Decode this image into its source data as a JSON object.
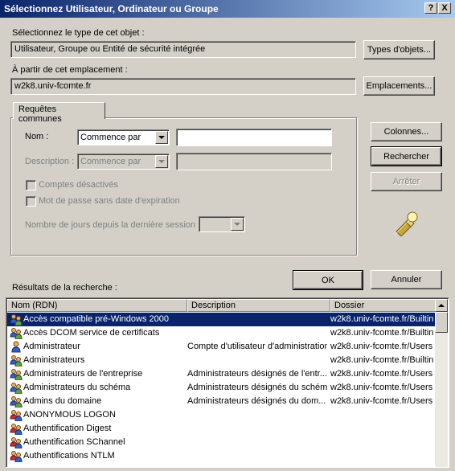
{
  "window": {
    "title": "Sélectionnez Utilisateur, Ordinateur ou Groupe",
    "help_glyph": "?",
    "close_glyph": "X"
  },
  "object_type": {
    "label": "Sélectionnez le type de cet objet :",
    "value": "Utilisateur, Groupe ou Entité de sécurité intégrée",
    "button": "Types d'objets..."
  },
  "location": {
    "label": "À partir de cet emplacement :",
    "value": "w2k8.univ-fcomte.fr",
    "button": "Emplacements..."
  },
  "common_queries": {
    "tab": "Requêtes communes",
    "name_label": "Nom :",
    "name_mode": "Commence par",
    "name_value": "",
    "description_label": "Description :",
    "description_mode": "Commence par",
    "disabled_accounts": "Comptes désactivés",
    "no_expire_password": "Mot de passe sans date d'expiration",
    "days_label": "Nombre de jours depuis la dernière session :"
  },
  "buttons": {
    "columns": "Colonnes...",
    "search": "Rechercher",
    "stop": "Arrêter",
    "ok": "OK",
    "cancel": "Annuler"
  },
  "results": {
    "label": "Résultats de la recherche :",
    "columns": [
      "Nom (RDN)",
      "Description",
      "Dossier"
    ],
    "rows": [
      {
        "name": "Accès compatible pré-Windows 2000",
        "description": "",
        "folder": "w2k8.univ-fcomte.fr/Builtin",
        "icon": "group-icon",
        "selected": true
      },
      {
        "name": "Accès DCOM service de certificats",
        "description": "",
        "folder": "w2k8.univ-fcomte.fr/Builtin",
        "icon": "group-icon",
        "selected": false
      },
      {
        "name": "Administrateur",
        "description": "Compte d'utilisateur d'administration",
        "folder": "w2k8.univ-fcomte.fr/Users",
        "icon": "user-icon",
        "selected": false
      },
      {
        "name": "Administrateurs",
        "description": "",
        "folder": "w2k8.univ-fcomte.fr/Builtin",
        "icon": "group-icon",
        "selected": false
      },
      {
        "name": "Administrateurs de l'entreprise",
        "description": "Administrateurs désignés de l'entr...",
        "folder": "w2k8.univ-fcomte.fr/Users",
        "icon": "group-icon",
        "selected": false
      },
      {
        "name": "Administrateurs du schéma",
        "description": "Administrateurs désignés du schéma...",
        "folder": "w2k8.univ-fcomte.fr/Users",
        "icon": "group-icon",
        "selected": false
      },
      {
        "name": "Admins du domaine",
        "description": "Administrateurs désignés du dom...",
        "folder": "w2k8.univ-fcomte.fr/Users",
        "icon": "group-icon",
        "selected": false
      },
      {
        "name": "ANONYMOUS LOGON",
        "description": "",
        "folder": "",
        "icon": "security-principal-icon",
        "selected": false
      },
      {
        "name": "Authentification Digest",
        "description": "",
        "folder": "",
        "icon": "security-principal-icon",
        "selected": false
      },
      {
        "name": "Authentification SChannel",
        "description": "",
        "folder": "",
        "icon": "security-principal-icon",
        "selected": false
      },
      {
        "name": "Authentifications NTLM",
        "description": "",
        "folder": "",
        "icon": "security-principal-icon",
        "selected": false
      }
    ]
  }
}
